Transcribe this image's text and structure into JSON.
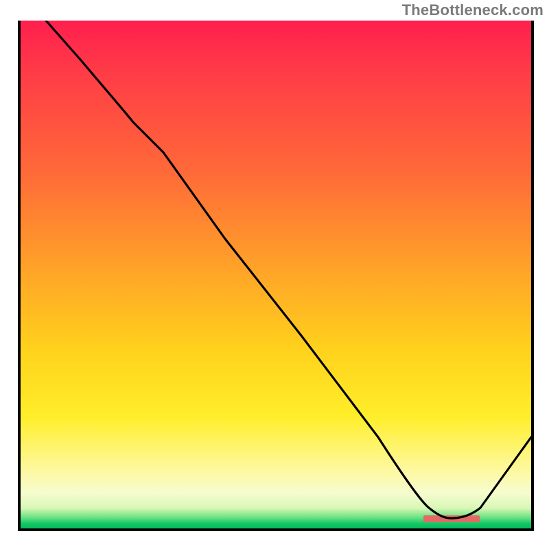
{
  "attribution": "TheBottleneck.com",
  "colors": {
    "gradient_top": "#ff1f4e",
    "gradient_mid1": "#ff6a38",
    "gradient_mid2": "#ffd21c",
    "gradient_pale": "#fef89a",
    "gradient_green": "#00bd5a",
    "curve": "#000000",
    "optimum_bar": "#e16a64",
    "frame": "#000000"
  },
  "chart_data": {
    "type": "line",
    "title": "",
    "xlabel": "",
    "ylabel": "",
    "xlim": [
      0,
      100
    ],
    "ylim": [
      0,
      100
    ],
    "grid": false,
    "legend": false,
    "annotation_note": "Color gradient background encodes bottleneck severity (red high, green low); black curve shows bottleneck percentage vs. some hardware pairing axis; pink bar marks optimum region",
    "series": [
      {
        "name": "bottleneck_curve",
        "x": [
          5,
          12,
          22,
          28,
          40,
          55,
          70,
          80,
          85,
          90,
          100
        ],
        "y": [
          100,
          92,
          80,
          74,
          57,
          38,
          18,
          4,
          2,
          4,
          18
        ]
      }
    ],
    "optimum_range_x": [
      79,
      90
    ],
    "optimum_y": 2
  }
}
